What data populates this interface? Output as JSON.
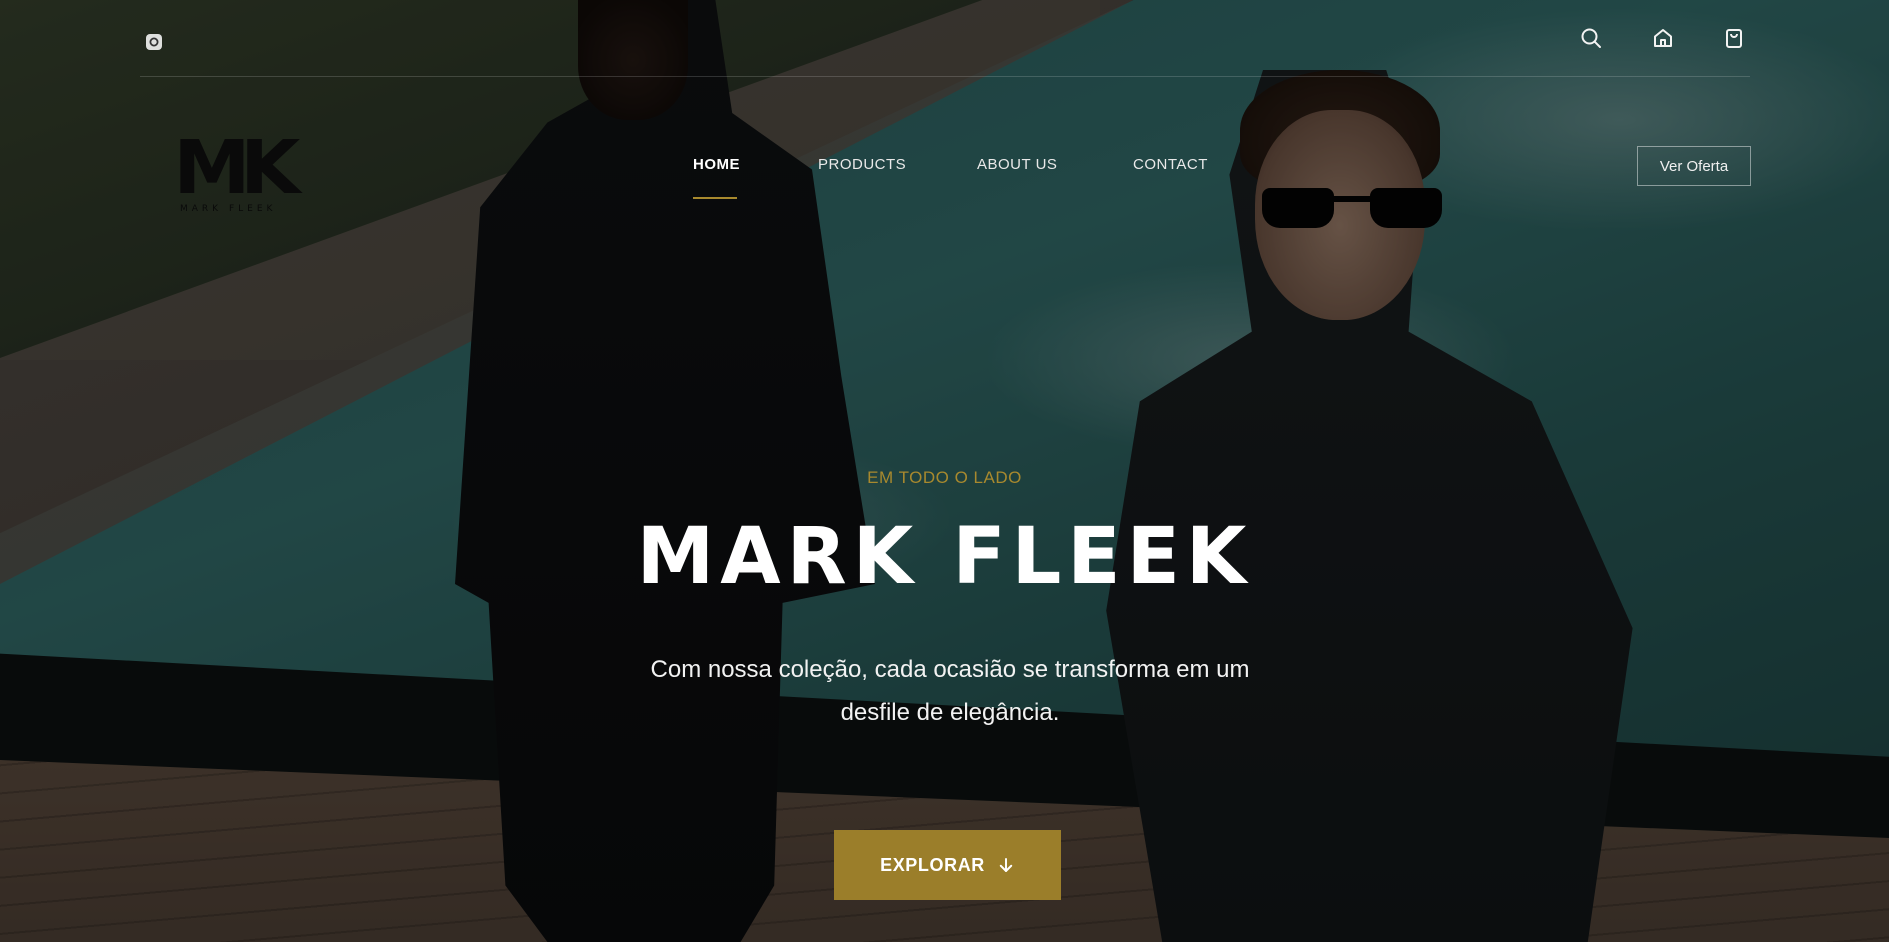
{
  "topbar": {
    "social_icon": "instagram-icon",
    "right_icons": [
      "search-icon",
      "home-icon",
      "shopping-bag-icon"
    ]
  },
  "logo": {
    "mark": "MK",
    "sub": "MARK FLEEK"
  },
  "nav": {
    "items": [
      {
        "label": "HOME",
        "active": true
      },
      {
        "label": "PRODUCTS",
        "active": false
      },
      {
        "label": "ABOUT US",
        "active": false
      },
      {
        "label": "CONTACT",
        "active": false
      }
    ],
    "cta_label": "Ver Oferta"
  },
  "hero": {
    "eyebrow": "EM TODO O LADO",
    "title": "MARK FLEEK",
    "subtitle": "Com nossa coleção, cada ocasião se transforma em um desfile de elegância.",
    "button_label": "EXPLORAR",
    "button_icon": "arrow-down-icon"
  },
  "colors": {
    "accent": "#a8892e",
    "button_bg": "#9b7e2a",
    "text": "#ffffff"
  }
}
